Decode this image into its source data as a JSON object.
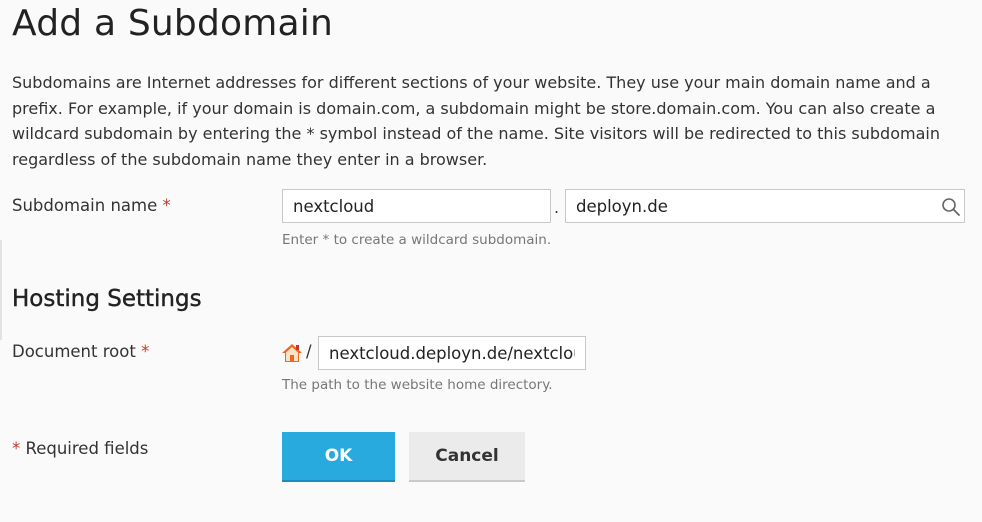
{
  "page": {
    "title": "Add a Subdomain",
    "intro": "Subdomains are Internet addresses for different sections of your website. They use your main domain name and a prefix. For example, if your domain is domain.com, a subdomain might be store.domain.com. You can also create a wildcard subdomain by entering the * symbol instead of the name. Site visitors will be redirected to this subdomain regardless of the subdomain name they enter in a browser."
  },
  "subdomain": {
    "label": "Subdomain name",
    "required_mark": "*",
    "name_value": "nextcloud",
    "separator": ".",
    "domain_value": "deployn.de",
    "hint": "Enter * to create a wildcard subdomain."
  },
  "hosting": {
    "heading": "Hosting Settings",
    "docroot_label": "Document root",
    "required_mark": "*",
    "path_prefix": "/",
    "docroot_value": "nextcloud.deployn.de/nextcloud",
    "hint": "The path to the website home directory."
  },
  "footer": {
    "required_mark": "*",
    "required_text": "Required fields"
  },
  "buttons": {
    "ok": "OK",
    "cancel": "Cancel"
  },
  "colors": {
    "primary": "#28aadf",
    "required": "#c0392b",
    "home_icon": "#f26522"
  },
  "icons": {
    "domain_search": "search-icon",
    "docroot_home": "home-icon"
  }
}
